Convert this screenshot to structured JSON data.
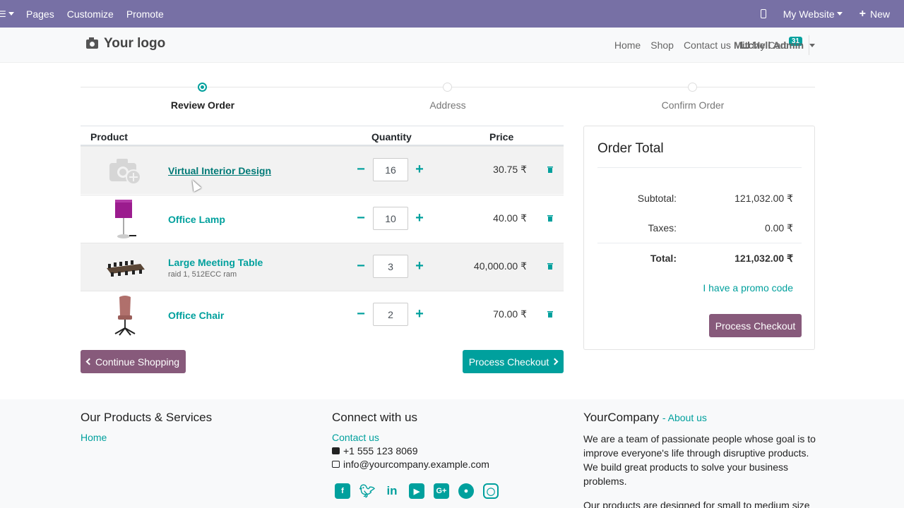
{
  "admin_bar": {
    "menu": [
      "Pages",
      "Customize",
      "Promote"
    ],
    "my_website": "My Website",
    "new": "New"
  },
  "header": {
    "logo_text": "Your logo",
    "nav": [
      "Home",
      "Shop",
      "Contact us"
    ],
    "cart_label": "My Cart",
    "cart_count": "31",
    "user": "Mitchell Admin"
  },
  "wizard": {
    "steps": [
      "Review Order",
      "Address",
      "Confirm Order"
    ],
    "active_step": 0
  },
  "cart": {
    "columns": {
      "product": "Product",
      "quantity": "Quantity",
      "price": "Price"
    },
    "items": [
      {
        "name": "Virtual Interior Design",
        "description": "",
        "quantity": "16",
        "price": "30.75 ₹",
        "image": "placeholder-camera-icon"
      },
      {
        "name": "Office Lamp",
        "description": "",
        "quantity": "10",
        "price": "40.00 ₹",
        "image": "lamp-image"
      },
      {
        "name": "Large Meeting Table",
        "description": "raid 1, 512ECC ram",
        "quantity": "3",
        "price": "40,000.00 ₹",
        "image": "table-image"
      },
      {
        "name": "Office Chair",
        "description": "",
        "quantity": "2",
        "price": "70.00 ₹",
        "image": "chair-image"
      }
    ],
    "continue_label": "Continue Shopping",
    "checkout_label": "Process Checkout"
  },
  "order_total": {
    "title": "Order Total",
    "subtotal_label": "Subtotal:",
    "subtotal": "121,032.00 ₹",
    "taxes_label": "Taxes:",
    "taxes": "0.00 ₹",
    "total_label": "Total:",
    "total": "121,032.00 ₹",
    "promo": "I have a promo code",
    "checkout_label": "Process Checkout"
  },
  "footer": {
    "col1_title": "Our Products & Services",
    "col1_link": "Home",
    "col2_title": "Connect with us",
    "col2_link": "Contact us",
    "phone": "+1 555 123 8069",
    "email": "info@yourcompany.example.com",
    "col3_title": "YourCompany",
    "col3_link": "- About us",
    "about_p1": "We are a team of passionate people whose goal is to improve everyone's life through disruptive products. We build great products to solve your business problems.",
    "about_p2": "Our products are designed for small to medium size companies willing to optimize their performance.",
    "socials": [
      "facebook-icon",
      "twitter-icon",
      "linkedin-icon",
      "youtube-icon",
      "google-plus-icon",
      "github-icon",
      "instagram-icon"
    ]
  },
  "colors": {
    "admin_bar": "#7770a5",
    "primary": "#00a09d",
    "secondary": "#875a7b"
  }
}
